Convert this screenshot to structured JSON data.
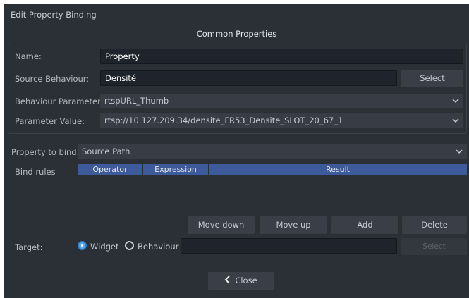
{
  "window": {
    "title": "Edit Property Binding"
  },
  "common": {
    "heading": "Common Properties",
    "name_label": "Name:",
    "name_value": "Property",
    "source_label": "Source Behaviour:",
    "source_value": "Densité",
    "select_label": "Select",
    "param_label": "Behaviour Parameter:",
    "param_value": "rtspURL_Thumb",
    "value_label": "Parameter Value:",
    "value_value": "rtsp://10.127.209.34/densite_FR53_Densite_SLOT_20_67_1"
  },
  "binding": {
    "property_label": "Property to bind",
    "property_value": "Source Path",
    "rules_label": "Bind rules",
    "columns": [
      "Operator",
      "Expression",
      "Result"
    ],
    "buttons": {
      "move_down": "Move down",
      "move_up": "Move up",
      "add": "Add",
      "delete": "Delete"
    }
  },
  "target": {
    "label": "Target:",
    "widget_label": "Widget",
    "behaviour_label": "Behaviour",
    "selected": "Widget",
    "select_label": "Select"
  },
  "footer": {
    "close_label": "Close"
  },
  "colors": {
    "accent": "#3d5a9a",
    "radio_on": "#5aa8e6",
    "dialog_bg": "#2b2f36"
  }
}
